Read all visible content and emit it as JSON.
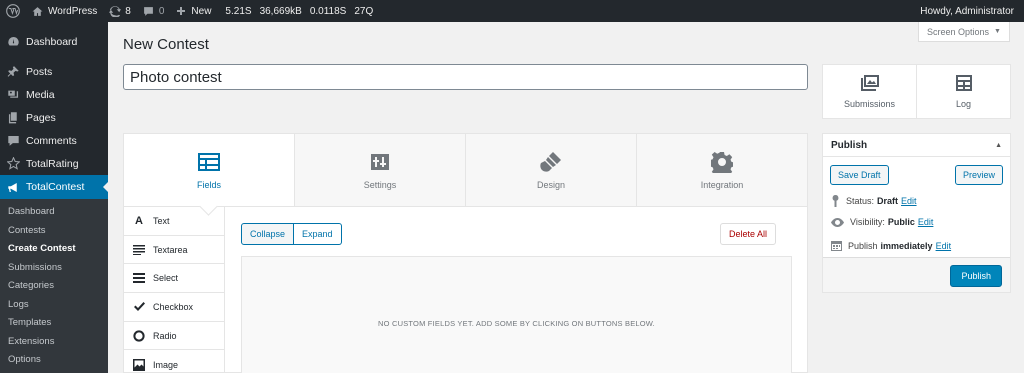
{
  "adminbar": {
    "site_name": "WordPress",
    "updates_count": "8",
    "comments_count": "0",
    "new_label": "New",
    "stats": [
      "5.21S",
      "36,669kB",
      "0.0118S",
      "27Q"
    ],
    "greeting": "Howdy, Administrator"
  },
  "sidebar": {
    "items": [
      {
        "label": "Dashboard",
        "icon": "dashboard-icon"
      },
      {
        "label": "Posts",
        "icon": "pin-icon"
      },
      {
        "label": "Media",
        "icon": "media-icon"
      },
      {
        "label": "Pages",
        "icon": "pages-icon"
      },
      {
        "label": "Comments",
        "icon": "comment-icon"
      },
      {
        "label": "TotalRating",
        "icon": "star-icon"
      },
      {
        "label": "TotalContest",
        "icon": "megaphone-icon"
      }
    ],
    "submenu": [
      "Dashboard",
      "Contests",
      "Create Contest",
      "Submissions",
      "Categories",
      "Logs",
      "Templates",
      "Extensions",
      "Options"
    ]
  },
  "screen_options": "Screen Options",
  "page_title": "New Contest",
  "title_input_value": "Photo contest",
  "tabs": [
    "Fields",
    "Settings",
    "Design",
    "Integration"
  ],
  "field_types": [
    "Text",
    "Textarea",
    "Select",
    "Checkbox",
    "Radio",
    "Image"
  ],
  "fields": {
    "collapse": "Collapse",
    "expand": "Expand",
    "delete_all": "Delete All",
    "empty_message": "NO CUSTOM FIELDS YET. ADD SOME BY CLICKING ON BUTTONS BELOW."
  },
  "side_links": {
    "submissions": "Submissions",
    "log": "Log"
  },
  "publish": {
    "title": "Publish",
    "toggle": "▲",
    "save_draft": "Save Draft",
    "preview": "Preview",
    "status_label": "Status:",
    "status_value": "Draft",
    "visibility_label": "Visibility:",
    "visibility_value": "Public",
    "schedule_label": "Publish",
    "schedule_value": "immediately",
    "edit": "Edit",
    "publish_button": "Publish"
  },
  "colors": {
    "adminbar_bg": "#23282d",
    "accent": "#0073aa",
    "publish_button": "#0085ba",
    "delete": "#a00"
  }
}
